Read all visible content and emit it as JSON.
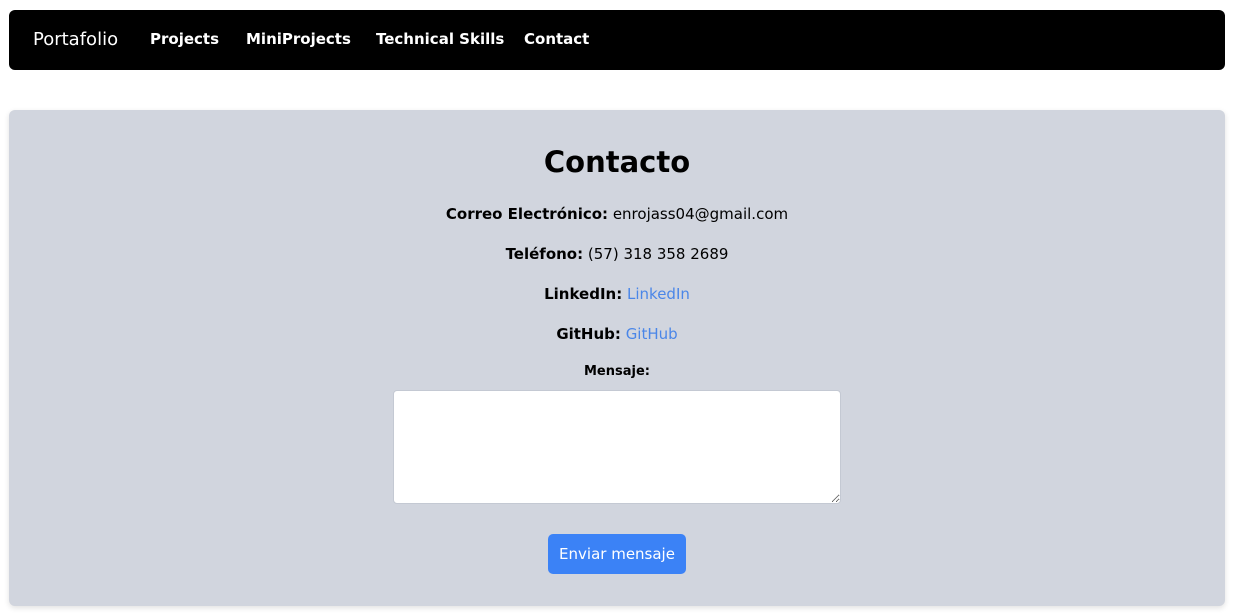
{
  "navbar": {
    "brand": "Portafolio",
    "links": [
      "Projects",
      "MiniProjects",
      "Technical Skills",
      "Contact"
    ]
  },
  "contact": {
    "title": "Contacto",
    "email": {
      "label": "Correo Electrónico:",
      "value": "enrojass04@gmail.com"
    },
    "phone": {
      "label": "Teléfono:",
      "value": "(57) 318 358 2689"
    },
    "linkedin": {
      "label": "LinkedIn:",
      "link_text": "LinkedIn"
    },
    "github": {
      "label": "GitHub:",
      "link_text": "GitHub"
    },
    "message_label": "Mensaje:",
    "message_value": "",
    "submit_label": "Enviar mensaje"
  },
  "colors": {
    "navbar_bg": "#000000",
    "card_bg": "#d1d5de",
    "link": "#4a86e8",
    "button": "#3b82f6"
  }
}
